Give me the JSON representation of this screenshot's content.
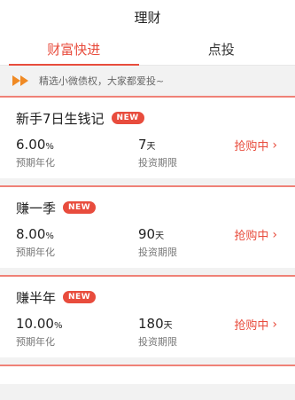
{
  "header": {
    "title": "理财"
  },
  "tabs": [
    {
      "label": "财富快进",
      "active": true
    },
    {
      "label": "点投",
      "active": false
    }
  ],
  "notice": {
    "text": "精选小微债权，大家都爱投~",
    "icon": "double-arrow-right-icon"
  },
  "colors": {
    "accent": "#e84c3d"
  },
  "products": [
    {
      "title": "新手7日生钱记",
      "badge": "NEW",
      "rate": "6.00",
      "rate_unit": "%",
      "rate_label": "预期年化",
      "term": "7",
      "term_unit": "天",
      "term_label": "投资期限",
      "action": "抢购中"
    },
    {
      "title": "赚一季",
      "badge": "NEW",
      "rate": "8.00",
      "rate_unit": "%",
      "rate_label": "预期年化",
      "term": "90",
      "term_unit": "天",
      "term_label": "投资期限",
      "action": "抢购中"
    },
    {
      "title": "赚半年",
      "badge": "NEW",
      "rate": "10.00",
      "rate_unit": "%",
      "rate_label": "预期年化",
      "term": "180",
      "term_unit": "天",
      "term_label": "投资期限",
      "action": "抢购中"
    }
  ]
}
